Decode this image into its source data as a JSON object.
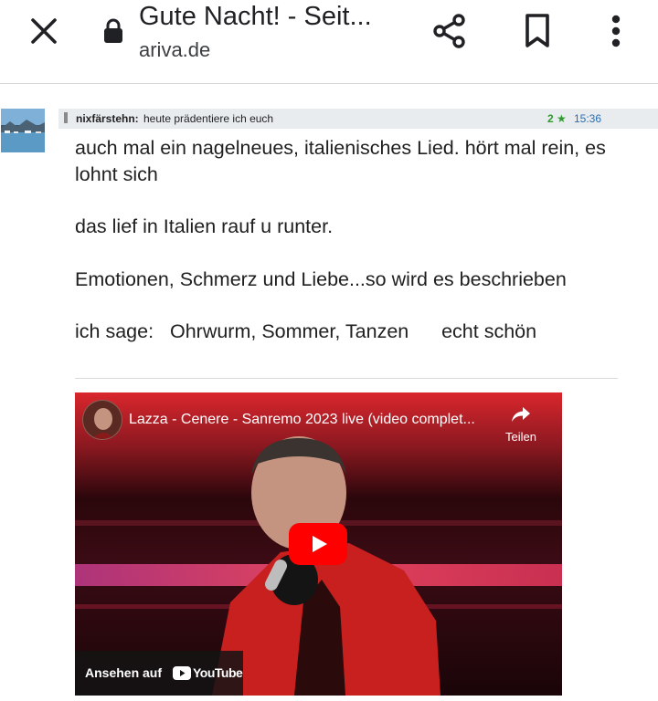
{
  "browser": {
    "title": "Gute Nacht! - Seit...",
    "domain": "ariva.de",
    "icons": {
      "close": "close-icon",
      "lock": "lock-icon",
      "share": "share-icon",
      "bookmark": "bookmark-icon",
      "menu": "more-vert-icon"
    }
  },
  "post": {
    "username": "nixfärstehn:",
    "subject": "heute prädentiere ich euch",
    "stars": "2 ★",
    "time": "15:36",
    "paragraphs": [
      "auch mal ein nagelneues, italienisches Lied.  hört mal rein, es lohnt sich",
      "das lief in Italien rauf u runter.",
      "Emotionen, Schmerz und Liebe...so wird es beschrieben",
      "ich sage:   Ohrwurm, Sommer, Tanzen      echt schön"
    ]
  },
  "video": {
    "title": "Lazza - Cenere - Sanremo 2023 live (video complet...",
    "share_label": "Teilen",
    "watch_on_label": "Ansehen auf",
    "youtube_label": "YouTube"
  },
  "colors": {
    "stars": "#2e9a2e",
    "time": "#2a6db0",
    "header_bg": "#e9ecef",
    "youtube_red": "#ff0000"
  }
}
